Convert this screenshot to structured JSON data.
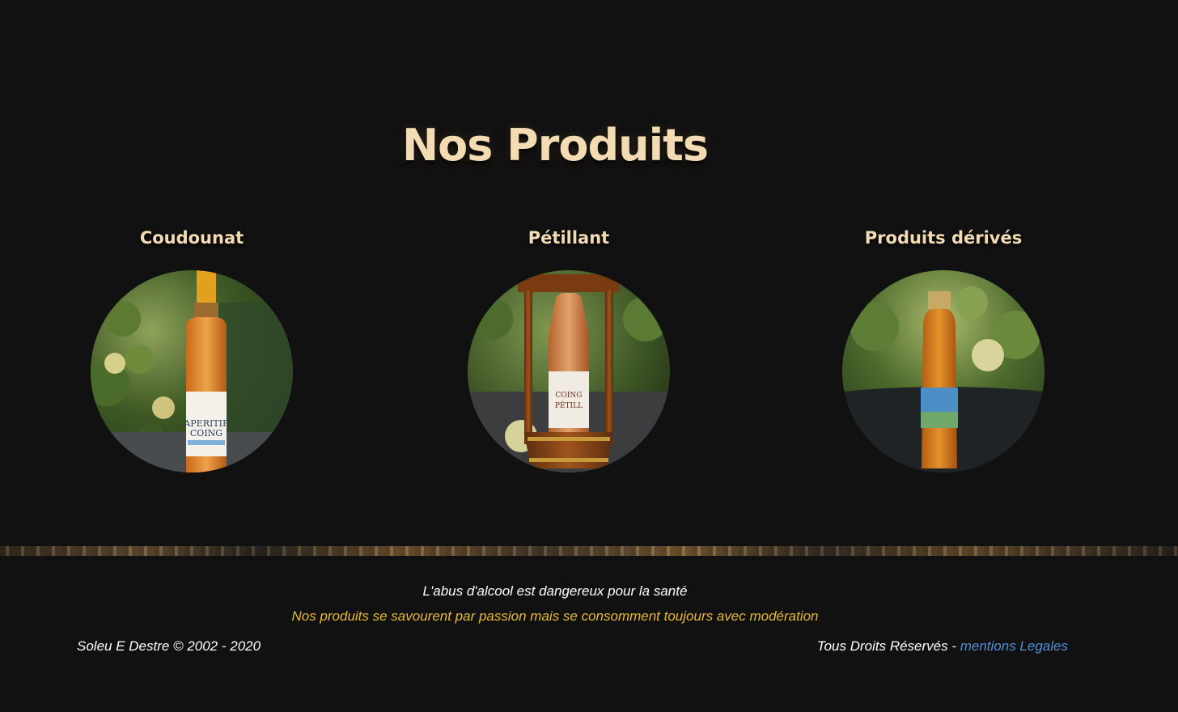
{
  "main": {
    "title": "Nos Produits",
    "products": [
      {
        "title": "Coudounat",
        "image_label": "APERITIF DE COING"
      },
      {
        "title": "Pétillant",
        "image_label": "COING PÉTILL"
      },
      {
        "title": "Produits dérivés",
        "image_label": ""
      }
    ]
  },
  "footer": {
    "warning": "L'abus d'alcool est dangereux pour la santé",
    "moderation": "Nos produits se savourent par passion mais se consomment toujours avec modération",
    "copyright": "Soleu E Destre © 2002 - 2020",
    "rights": "Tous Droits Réservés - ",
    "legal_link": "mentions Legales"
  },
  "colors": {
    "background": "#121112",
    "title": "#f3dcb4",
    "moderation_text": "#e7b930",
    "link": "#4f8fd6"
  }
}
